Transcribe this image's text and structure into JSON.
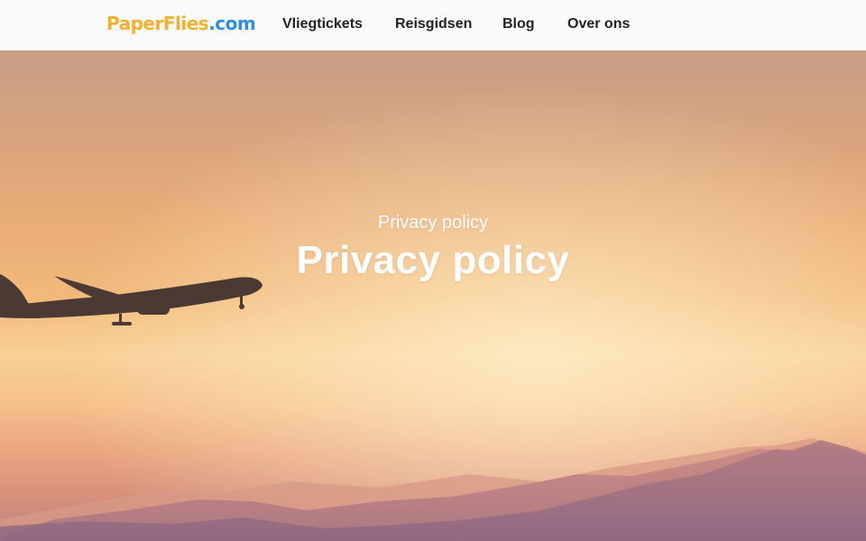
{
  "header": {
    "logo": {
      "part1": "PaperFlies",
      "part2": ".com",
      "color1": "#f4b02a",
      "color2": "#2e8ee0"
    },
    "nav": [
      {
        "label": "Vliegtickets"
      },
      {
        "label": "Reisgidsen"
      },
      {
        "label": "Blog"
      },
      {
        "label": "Over ons"
      }
    ]
  },
  "hero": {
    "eyebrow": "Privacy policy",
    "title": "Privacy policy",
    "image_icon": "airplane-over-mountains-sunset"
  }
}
